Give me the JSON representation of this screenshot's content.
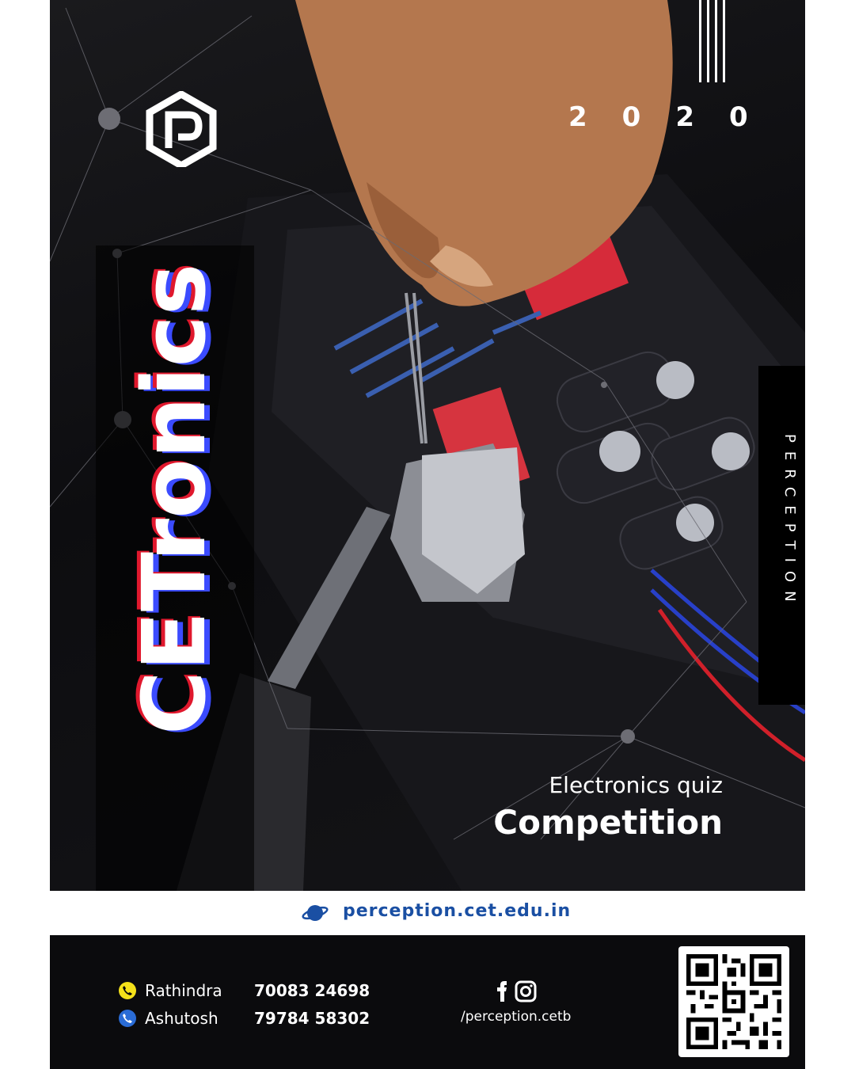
{
  "event": {
    "year": "2020",
    "title": "CETronics",
    "side_label": "PERCEPTION",
    "subtitle_line1": "Electronics quiz",
    "subtitle_line2": "Competition"
  },
  "website": {
    "url": "perception.cet.edu.in",
    "icon": "planet-icon"
  },
  "contacts": [
    {
      "name": "Rathindra",
      "phone": "70083 24698",
      "icon": "phone-icon",
      "color": "#f4e11a"
    },
    {
      "name": "Ashutosh",
      "phone": "79784 58302",
      "icon": "phone-icon",
      "color": "#2a6cd6"
    }
  ],
  "social": {
    "icons": [
      "facebook-icon",
      "instagram-icon"
    ],
    "handle": "/perception.cetb"
  },
  "colors": {
    "accent_blue": "#1a4fa3",
    "title_red": "#e0182d",
    "title_blue": "#3b4bff"
  }
}
